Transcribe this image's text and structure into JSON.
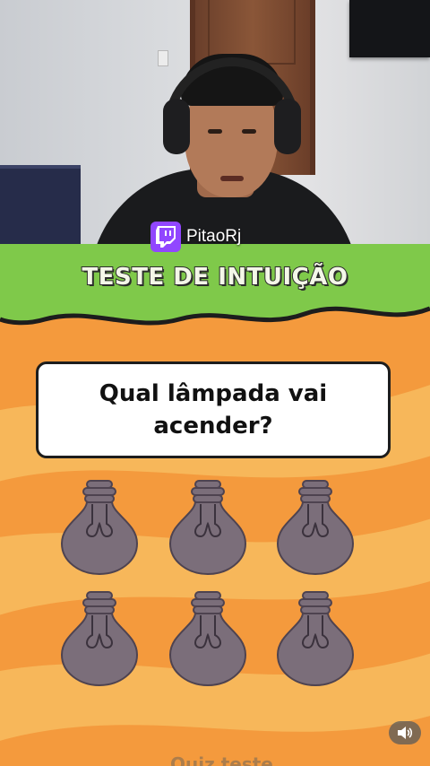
{
  "stream": {
    "streamer_name": "PitaoRj",
    "platform_icon": "twitch-icon",
    "platform_color": "#9146ff"
  },
  "quiz": {
    "title": "TESTE DE INTUIÇÃO",
    "question": "Qual lâmpada vai acender?",
    "bulbs": [
      {
        "label": "",
        "state": "off"
      },
      {
        "label": "",
        "state": "off"
      },
      {
        "label": "",
        "state": "off"
      },
      {
        "label": "",
        "state": "off"
      },
      {
        "label": "",
        "state": "off"
      },
      {
        "label": "",
        "state": "off"
      }
    ],
    "bottom_caption": "Quiz teste",
    "colors": {
      "header_green": "#7fc94a",
      "background_orange": "#f49a3d",
      "background_yellow": "#f7b75a",
      "bulb_fill": "#7b6e7a",
      "bulb_outline": "#4e4350"
    }
  },
  "controls": {
    "sound_icon": "speaker-icon"
  }
}
